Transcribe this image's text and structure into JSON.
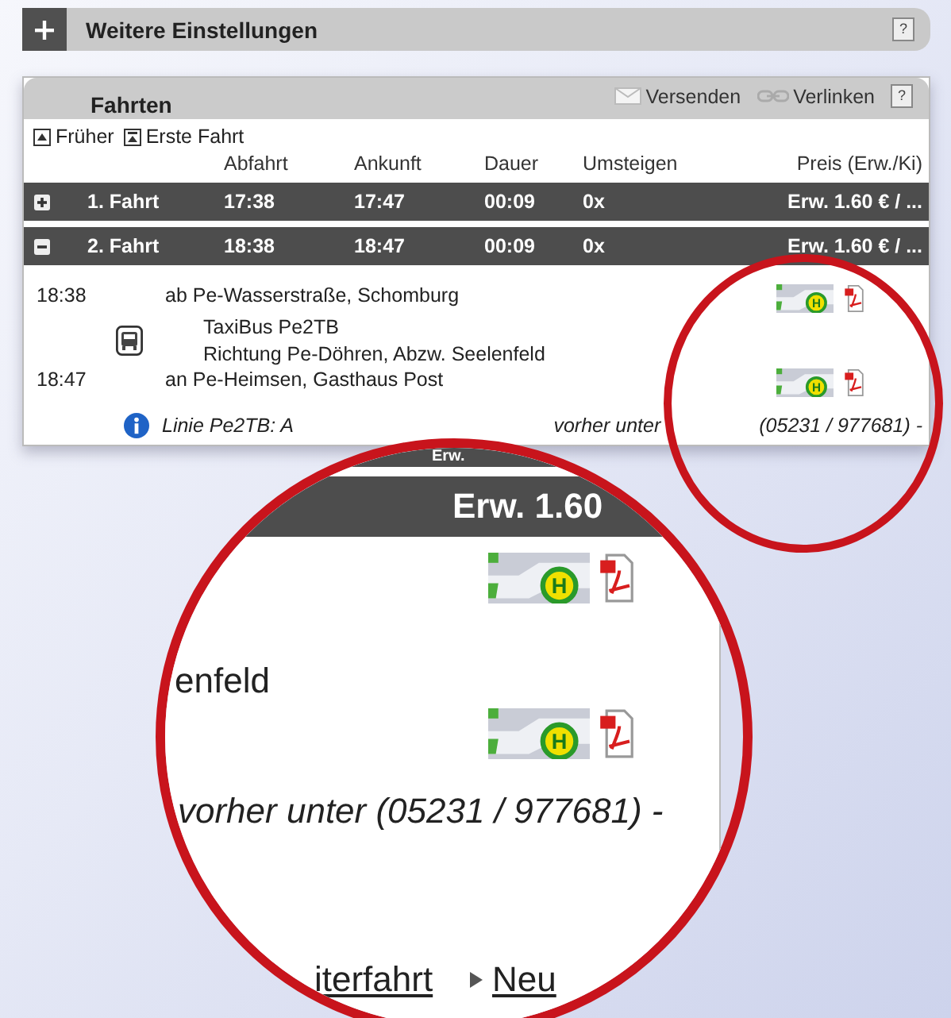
{
  "settings": {
    "title": "Weitere Einstellungen",
    "expanded": false,
    "help": "?"
  },
  "trips_panel": {
    "title": "Fahrten",
    "help": "?",
    "actions": [
      {
        "kind": "mail",
        "label": "Versenden"
      },
      {
        "kind": "link",
        "label": "Verlinken"
      }
    ],
    "nav": [
      {
        "kind": "earlier",
        "label": "Früher"
      },
      {
        "kind": "first",
        "label": "Erste Fahrt"
      }
    ],
    "columns": [
      "Abfahrt",
      "Ankunft",
      "Dauer",
      "Umsteigen",
      "Preis (Erw./Ki)"
    ],
    "trips": [
      {
        "expanded": false,
        "label": "1. Fahrt",
        "departure": "17:38",
        "arrival": "17:47",
        "duration": "00:09",
        "changes": "0x",
        "price": "Erw. 1.60 € / ..."
      },
      {
        "expanded": true,
        "label": "2. Fahrt",
        "departure": "18:38",
        "arrival": "18:47",
        "duration": "00:09",
        "changes": "0x",
        "price": "Erw. 1.60 € / ..."
      }
    ],
    "legs": [
      {
        "kind": "stop",
        "time": "18:38",
        "place": "ab Pe-Wasserstraße, Schomburg",
        "badge": "H"
      },
      {
        "kind": "vehicle",
        "line": "TaxiBus Pe2TB",
        "direction": "Richtung Pe-Döhren, Abzw. Seelenfeld"
      },
      {
        "kind": "stop",
        "time": "18:47",
        "place": "an Pe-Heimsen, Gasthaus Post",
        "badge": "H"
      }
    ],
    "note": {
      "start": "Linie Pe2TB: A",
      "middle": "vorher unter",
      "end": "(05231 / 977681) -"
    }
  },
  "magnifier": {
    "top_bar_text": "Erw.",
    "price": "Erw. 1.60",
    "badges": [
      "H",
      "H"
    ],
    "place_fragment": "enfeld",
    "note_fragment": "vorher unter (05231 / 977681) -",
    "links": [
      {
        "label": "iterfahrt",
        "arrow": false
      },
      {
        "label": "Neu",
        "arrow": true
      }
    ]
  }
}
